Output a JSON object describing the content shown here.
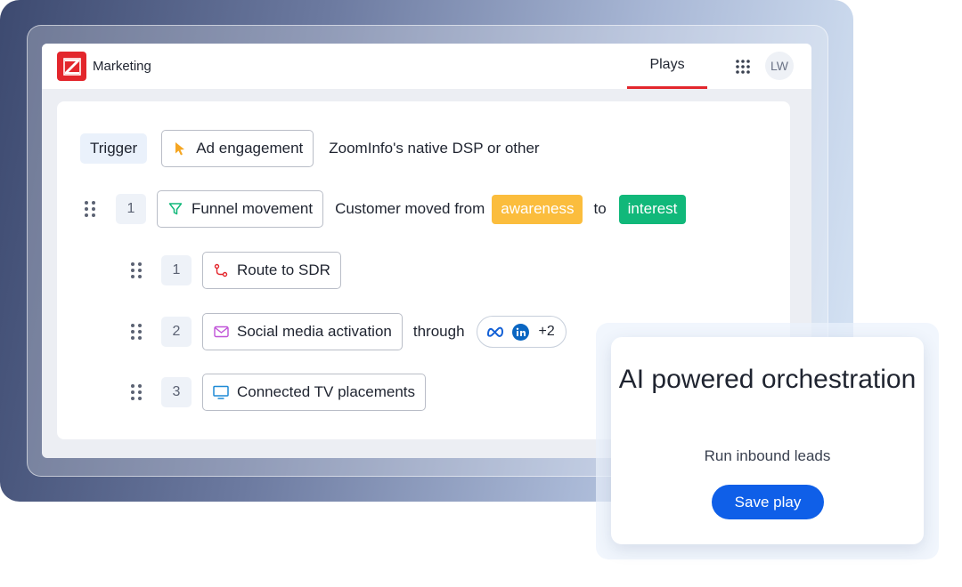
{
  "header": {
    "app_name": "Marketing",
    "active_tab": "Plays",
    "avatar_initials": "LW",
    "accent_color": "#e3262c"
  },
  "trigger": {
    "label": "Trigger",
    "event": "Ad engagement",
    "description": "ZoomInfo's native DSP or other"
  },
  "step": {
    "number": "1",
    "event": "Funnel movement",
    "description": "Customer moved from",
    "from_stage": "awareness",
    "connector": "to",
    "to_stage": "interest"
  },
  "actions": [
    {
      "number": "1",
      "label": "Route to SDR",
      "icon": "route-icon"
    },
    {
      "number": "2",
      "label": "Social media activation",
      "icon": "mail-icon",
      "suffix": "through",
      "channels_more": "+2"
    },
    {
      "number": "3",
      "label": "Connected TV placements",
      "icon": "tv-icon"
    }
  ],
  "promo": {
    "title": "AI powered orchestration",
    "subtitle": "Run inbound leads",
    "button": "Save play"
  }
}
